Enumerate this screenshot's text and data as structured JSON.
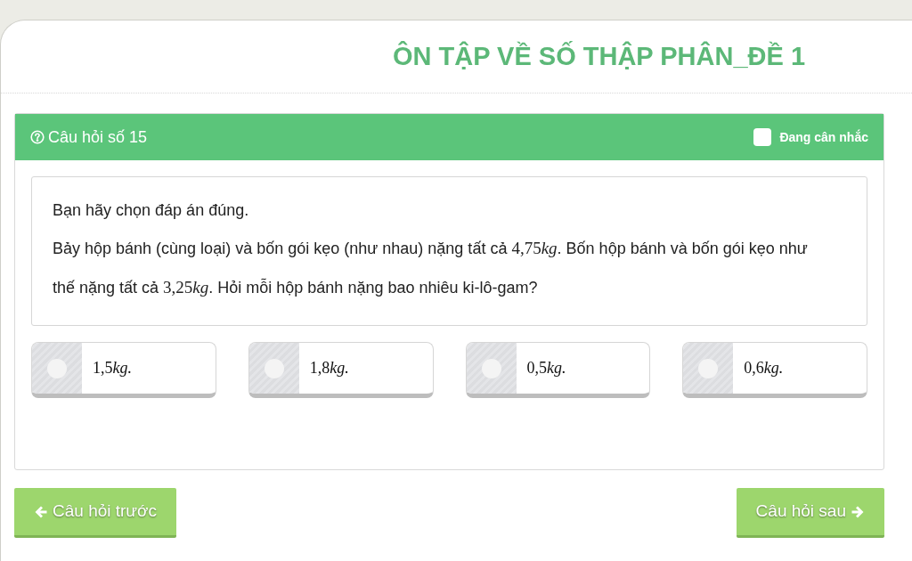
{
  "page_title": "ÔN TẬP VỀ SỐ THẬP PHÂN_ĐỀ 1",
  "question": {
    "heading": "Câu hỏi số 15",
    "flag": {
      "label": "Đang cân nhắc",
      "checked": false
    },
    "instruction": "Bạn hãy chọn đáp án đúng.",
    "text_parts": [
      {
        "kind": "text",
        "text": "Bảy hộp bánh (cùng loại) và bốn gói kẹo (như nhau) nặng tất cả "
      },
      {
        "kind": "math",
        "number": "4,75",
        "unit": "kg"
      },
      {
        "kind": "text",
        "text": ". Bốn hộp bánh và bốn gói kẹo như thế nặng tất cả "
      },
      {
        "kind": "math",
        "number": "3,25",
        "unit": "kg"
      },
      {
        "kind": "text",
        "text": ". Hỏi mỗi hộp bánh nặng bao nhiêu ki-lô-gam?"
      }
    ],
    "options": [
      {
        "number": "1,5",
        "unit": "kg",
        "end": ".",
        "selected": false
      },
      {
        "number": "1,8",
        "unit": "kg",
        "end": ".",
        "selected": false
      },
      {
        "number": "0,5",
        "unit": "kg",
        "end": ".",
        "selected": false
      },
      {
        "number": "0,6",
        "unit": "kg",
        "end": ".",
        "selected": false
      }
    ]
  },
  "navigation": {
    "previous": "Câu hỏi trước",
    "next": "Câu hỏi sau"
  }
}
